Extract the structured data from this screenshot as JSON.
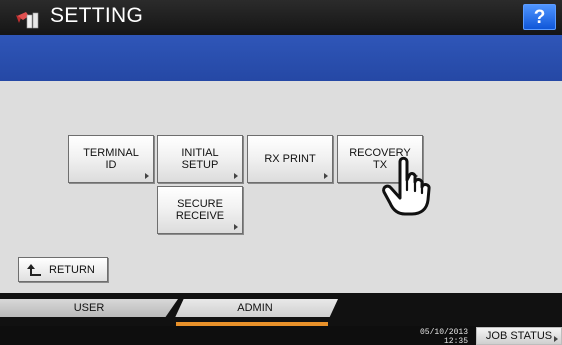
{
  "header": {
    "title": "SETTING",
    "help_label": "?",
    "logo_icon": "settings-wrench-icon"
  },
  "functions": [
    {
      "label": "TERMINAL\nID"
    },
    {
      "label": "INITIAL\nSETUP"
    },
    {
      "label": "RX PRINT"
    },
    {
      "label": "RECOVERY\nTX"
    },
    {
      "label": "SECURE\nRECEIVE"
    }
  ],
  "return_button": {
    "label": "RETURN",
    "icon": "return-arrow-icon"
  },
  "pointer_icon": "hand-pointer-icon",
  "tabs": [
    {
      "label": "USER"
    },
    {
      "label": "ADMIN",
      "active": true
    }
  ],
  "status_bar": {
    "date": "05/10/2013",
    "time": "12:35",
    "job_status_label": "JOB STATUS"
  },
  "colors": {
    "title_bar": "#1c1c1c",
    "blue_band": "#2a4fb0",
    "help_button": "#2f7bff",
    "active_tab_accent": "#e8912a"
  }
}
